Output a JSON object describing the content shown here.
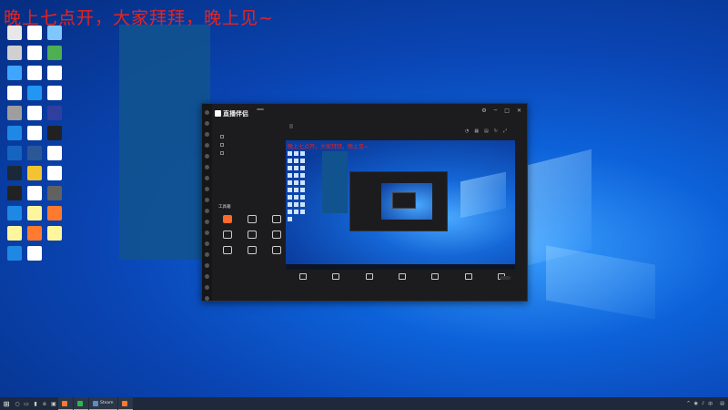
{
  "desktop": {
    "banner": "晚上七点开，大家拜拜，晚上见~",
    "icons": [
      {
        "label": "",
        "color": "#e8e8e8"
      },
      {
        "label": "",
        "color": "#ffffff"
      },
      {
        "label": "",
        "color": "#7ec7ff"
      },
      {
        "label": "",
        "color": "#d0d0d0"
      },
      {
        "label": "",
        "color": "#ffffff"
      },
      {
        "label": "",
        "color": "#4caf50"
      },
      {
        "label": "",
        "color": "#3ea6ff"
      },
      {
        "label": "",
        "color": "#ffffff"
      },
      {
        "label": "",
        "color": "#ffffff"
      },
      {
        "label": "",
        "color": "#ffffff"
      },
      {
        "label": "",
        "color": "#2196f3"
      },
      {
        "label": "",
        "color": "#ffffff"
      },
      {
        "label": "",
        "color": "#9e9e9e"
      },
      {
        "label": "",
        "color": "#ffffff"
      },
      {
        "label": "",
        "color": "#303f9f"
      },
      {
        "label": "",
        "color": "#1e88e5"
      },
      {
        "label": "",
        "color": "#ffffff"
      },
      {
        "label": "",
        "color": "#212121"
      },
      {
        "label": "",
        "color": "#1565c0"
      },
      {
        "label": "",
        "color": "#2b5797"
      },
      {
        "label": "",
        "color": "#ffffff"
      },
      {
        "label": "",
        "color": "#1b2838"
      },
      {
        "label": "",
        "color": "#f4c430"
      },
      {
        "label": "",
        "color": "#ffffff"
      },
      {
        "label": "",
        "color": "#222222"
      },
      {
        "label": "",
        "color": "#ffffff"
      },
      {
        "label": "",
        "color": "#616161"
      },
      {
        "label": "",
        "color": "#1e88e5"
      },
      {
        "label": "",
        "color": "#fff59d"
      },
      {
        "label": "",
        "color": "#ff7a2e"
      },
      {
        "label": "",
        "color": "#fff59d"
      },
      {
        "label": "",
        "color": "#ff7a2e"
      },
      {
        "label": "",
        "color": "#fff59d"
      },
      {
        "label": "",
        "color": "#1e88e5"
      },
      {
        "label": "",
        "color": "#ffffff"
      }
    ]
  },
  "app": {
    "title": "直播伴侣",
    "badge": "",
    "scene_tabs": [
      "",
      "",
      ""
    ],
    "scenes": [
      "",
      "",
      ""
    ],
    "tools_title": "工具箱",
    "tools": [
      {
        "label": "",
        "hot": true
      },
      {
        "label": "",
        "hot": false
      },
      {
        "label": "",
        "hot": false
      },
      {
        "label": "",
        "hot": false
      },
      {
        "label": "",
        "hot": false
      },
      {
        "label": "",
        "hot": false
      },
      {
        "label": "",
        "hot": false
      },
      {
        "label": "",
        "hot": false
      },
      {
        "label": "",
        "hot": false
      }
    ],
    "stream_title": "",
    "stream_tag": "",
    "stats": [
      "",
      "",
      "",
      ""
    ],
    "preview_banner": "晚上七点开，大家拜拜，晚上见~",
    "controls": [
      "",
      "",
      "",
      "",
      "",
      "",
      ""
    ],
    "start_live": "",
    "status": ""
  },
  "taskbar": {
    "tasks": [
      {
        "label": "",
        "kind": "live"
      },
      {
        "label": "",
        "kind": "wechat"
      },
      {
        "label": "Steam",
        "kind": "steam"
      },
      {
        "label": "",
        "kind": "live"
      }
    ],
    "time": "",
    "date": ""
  }
}
